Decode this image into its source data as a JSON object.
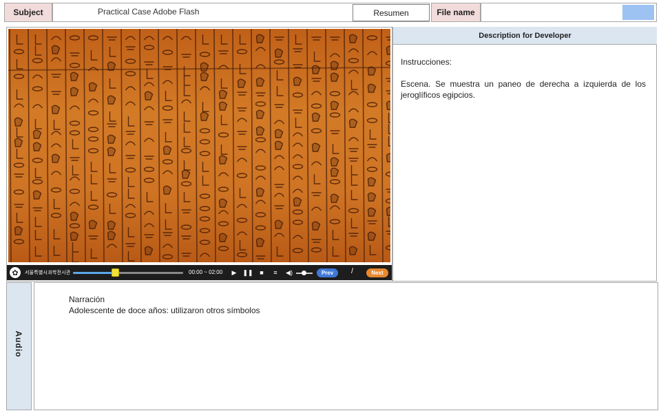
{
  "header": {
    "subject_label": "Subject",
    "subject_value": "Practical Case Adobe Flash",
    "resumen_button": "Resumen",
    "file_name_label": "File name",
    "file_name_value": ""
  },
  "player": {
    "brand": "서울특별시과학전시관",
    "time": "00:00 ~ 02:00",
    "progress": 0.38,
    "volume": 0.5,
    "play_icon": "play-icon",
    "pause_icon": "pause-icon",
    "stop_icon": "stop-icon",
    "menu_icon": "menu-icon",
    "volume_icon": "volume-icon",
    "prev_label": "Prev",
    "separator": "/",
    "next_label": "Next"
  },
  "description": {
    "header": "Description for Developer",
    "line1": "Instrucciones:",
    "line2": "Escena. Se muestra un paneo de derecha a izquierda de los jeroglíficos egipcios."
  },
  "audio": {
    "label": "Audio",
    "title": "Narración",
    "text": "Adolescente de doce años: utilizaron otros símbolos"
  },
  "colors": {
    "label_pink": "#f2dcdb",
    "panel_blue": "#dce6f1",
    "accent_blue": "#9dc3f3",
    "next_orange": "#e9882e",
    "prev_blue": "#3f78d8"
  }
}
